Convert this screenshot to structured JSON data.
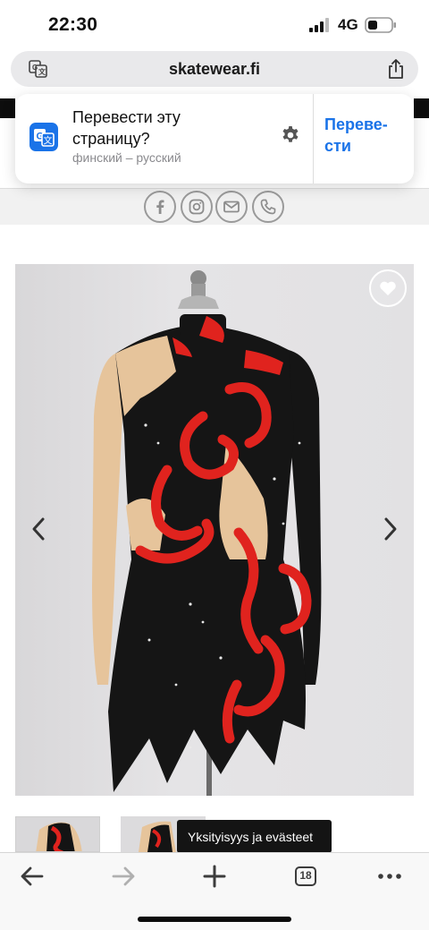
{
  "status_bar": {
    "time": "22:30",
    "network": "4G",
    "icons": [
      "signal-bars-icon",
      "battery-icon"
    ]
  },
  "browser": {
    "url": "skatewear.fi",
    "icons": [
      "translate-icon",
      "share-icon"
    ]
  },
  "translate_banner": {
    "title": "Перевести эту страницу?",
    "subtitle": "финский – русский",
    "action": "Переве-сти",
    "icons": [
      "translate-icon",
      "gear-icon"
    ]
  },
  "social_links": [
    "facebook-icon",
    "instagram-icon",
    "mail-icon",
    "phone-icon"
  ],
  "product": {
    "icons": [
      "heart-icon",
      "chevron-left-icon",
      "chevron-right-icon"
    ]
  },
  "cookie_chip": {
    "label": "Yksityisyys ja evästeet"
  },
  "toolbar": {
    "tabs_count": "18",
    "icons": [
      "arrow-left-icon",
      "arrow-right-icon",
      "plus-icon",
      "tabs-icon",
      "more-icon"
    ]
  },
  "colors": {
    "accent_blue": "#1a73e8",
    "dress_black": "#141414",
    "dress_red": "#e0231e",
    "skin_mesh": "#e8c9a3"
  }
}
